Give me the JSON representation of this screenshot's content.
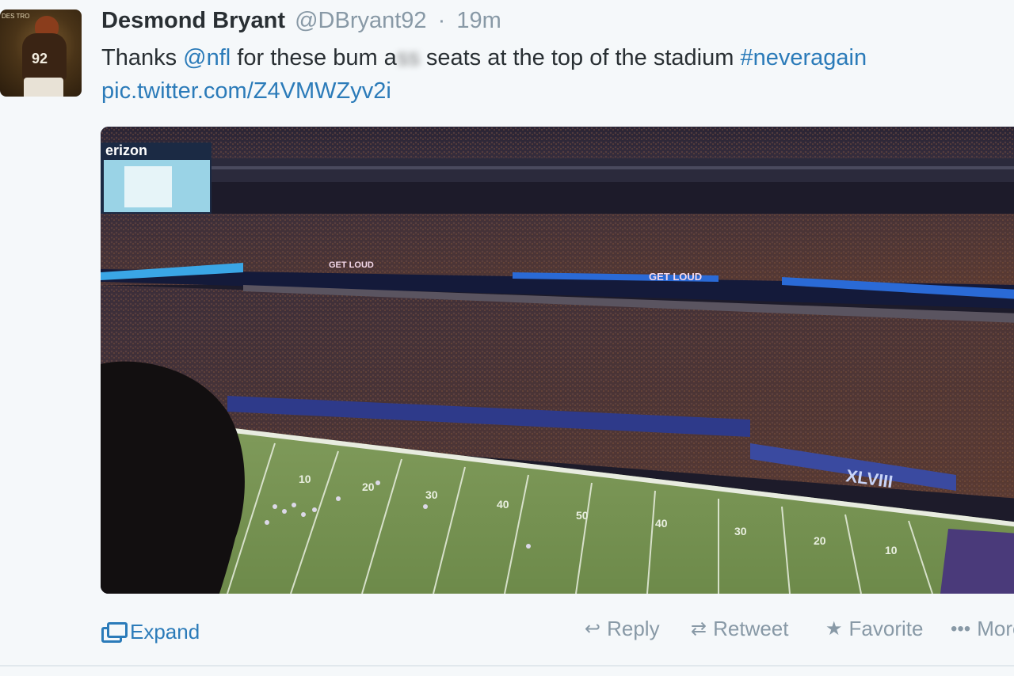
{
  "tweet": {
    "author_name": "Desmond Bryant",
    "author_handle": "@DBryant92",
    "separator": "·",
    "timestamp": "19m",
    "avatar_number": "92",
    "avatar_label": "DES TRO",
    "text_prefix": "Thanks ",
    "mention": "@nfl",
    "text_middle": " for these bum a",
    "censored": "ss",
    "text_suffix": " seats at the top of the stadium ",
    "hashtag": "#neveragain",
    "pic_link": "pic.twitter.com/Z4VMWZyv2i"
  },
  "photo": {
    "scoreboard_text": "erizon",
    "ribbon_text_1": "GET LOUD",
    "ribbon_text_2": "GET LOUD",
    "banner_text": "XLVIII",
    "field_numbers": [
      "10",
      "20",
      "30",
      "40",
      "50",
      "40",
      "30",
      "20",
      "10"
    ]
  },
  "actions": {
    "expand": "Expand",
    "reply": "Reply",
    "retweet": "Retweet",
    "favorite": "Favorite",
    "more": "More"
  },
  "icons": {
    "expand": "expand-media-icon",
    "reply": "reply-arrow-icon",
    "retweet": "retweet-arrows-icon",
    "favorite": "star-icon",
    "more": "ellipsis-icon"
  },
  "colors": {
    "link": "#2b7bb9",
    "muted": "#8899a6",
    "text": "#292f33",
    "background": "#f5f8fa"
  }
}
